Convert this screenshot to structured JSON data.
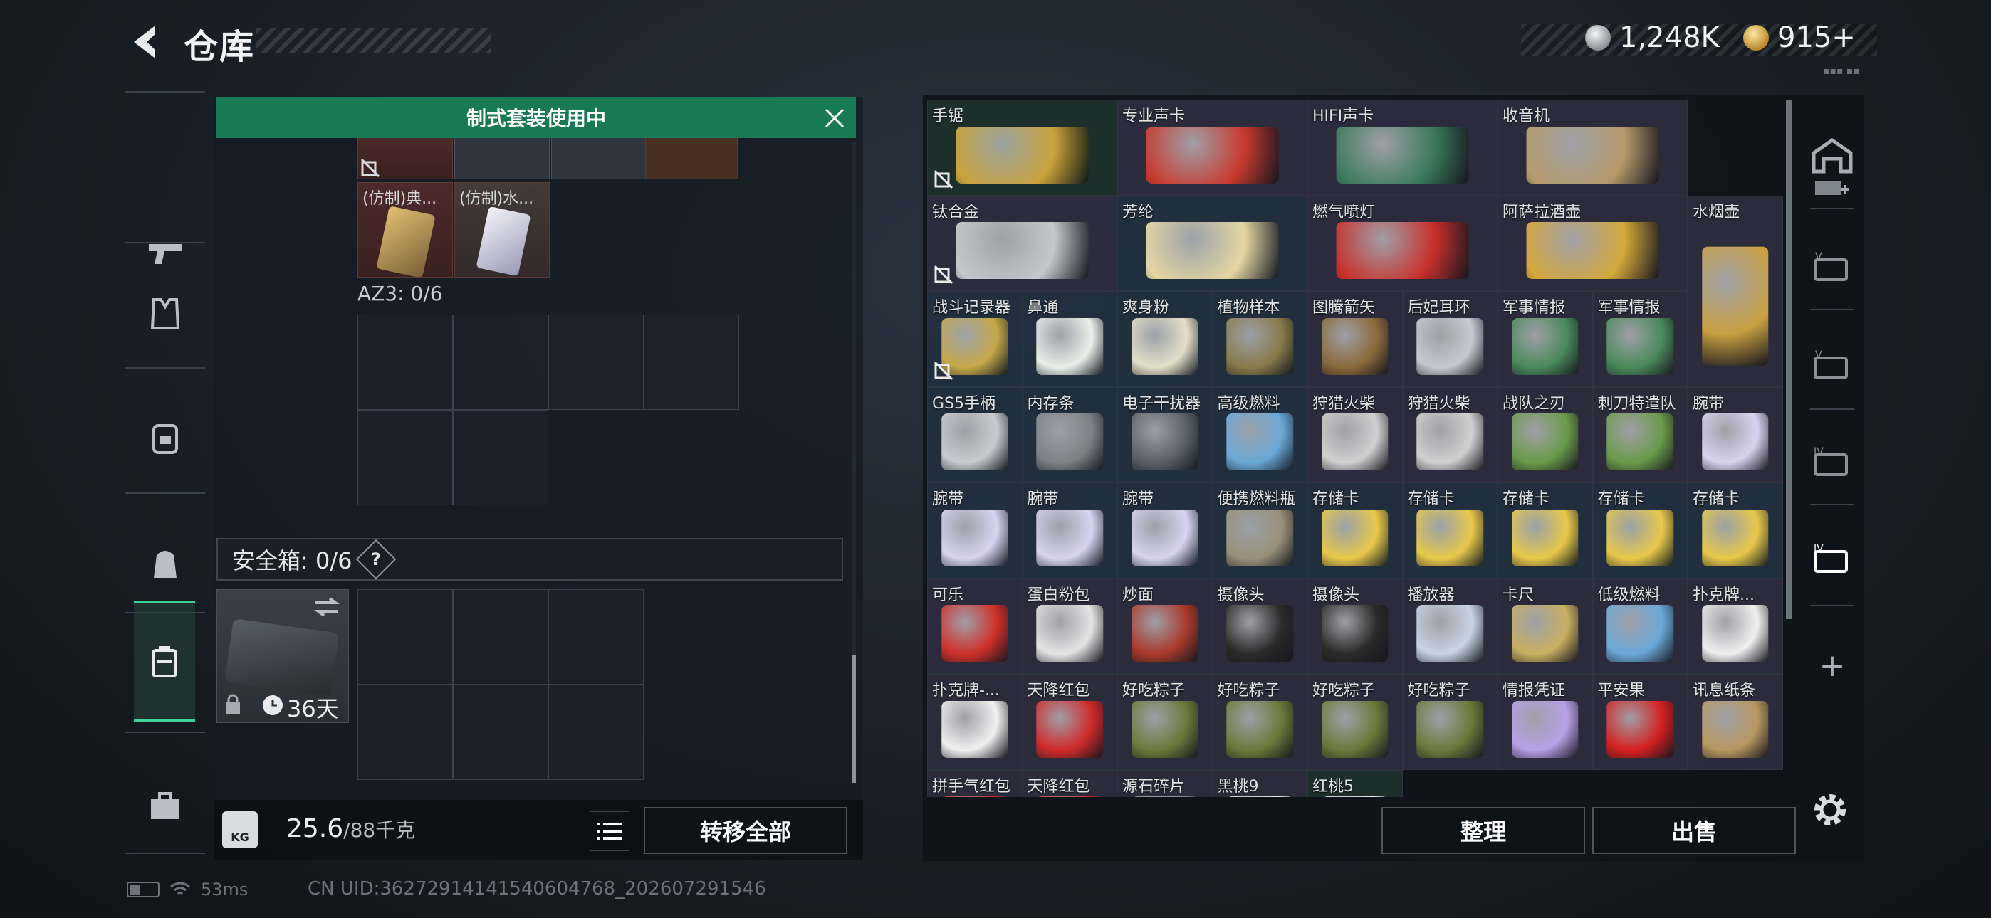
{
  "header": {
    "title": "仓库"
  },
  "currency": {
    "silver": "1,248K",
    "gold": "915+"
  },
  "left": {
    "banner": "制式套装使用中",
    "items": [
      "(仿制)典...",
      "(仿制)水..."
    ],
    "az3_label": "AZ3: 0/6",
    "safe_box": {
      "label": "安全箱: 0/6",
      "help": "?"
    },
    "case_days": "36天",
    "weight": {
      "value": "25.6",
      "max": "/88千克",
      "icon_text": "KG"
    },
    "transfer_all": "转移全部"
  },
  "inventory": {
    "rows": [
      [
        {
          "name": "手锯",
          "span": 2,
          "color": "green",
          "icon": "hacksaw-icon",
          "nolock": true
        },
        {
          "name": "专业声卡",
          "span": 2,
          "color": "purple",
          "icon": "sound-card-icon"
        },
        {
          "name": "HIFI声卡",
          "span": 2,
          "color": "purple",
          "icon": "hifi-card-icon"
        },
        {
          "name": "收音机",
          "span": 2,
          "color": "purple",
          "icon": "radio-icon"
        }
      ],
      [
        {
          "name": "钛合金",
          "span": 2,
          "color": "purple",
          "icon": "titanium-plate-icon",
          "nolock": true
        },
        {
          "name": "芳纶",
          "span": 2,
          "color": "blue",
          "icon": "aramid-roll-icon"
        },
        {
          "name": "燃气喷灯",
          "span": 2,
          "color": "purple",
          "icon": "gas-torch-icon"
        },
        {
          "name": "阿萨拉酒壶",
          "span": 2,
          "color": "purple",
          "icon": "wine-jug-icon"
        },
        {
          "name": "水烟壶",
          "span": 1,
          "color": "purple",
          "icon": "hookah-icon",
          "rowspan": 2
        }
      ],
      [
        {
          "name": "战斗记录器",
          "color": "blue",
          "icon": "combat-recorder-icon",
          "nolock": true
        },
        {
          "name": "鼻通",
          "color": "blue",
          "icon": "nasal-stick-icon"
        },
        {
          "name": "爽身粉",
          "color": "blue",
          "icon": "powder-can-icon"
        },
        {
          "name": "植物样本",
          "color": "blue",
          "icon": "plant-sample-icon"
        },
        {
          "name": "图腾箭矢",
          "color": "purple",
          "icon": "totem-arrow-icon"
        },
        {
          "name": "后妃耳环",
          "color": "purple",
          "icon": "earring-icon"
        },
        {
          "name": "军事情报",
          "color": "purple",
          "icon": "intel-board-icon"
        },
        {
          "name": "军事情报",
          "color": "purple",
          "icon": "intel-board-icon"
        }
      ],
      [
        {
          "name": "GS5手柄",
          "color": "blue",
          "icon": "gamepad-icon"
        },
        {
          "name": "内存条",
          "color": "blue",
          "icon": "ram-stick-icon"
        },
        {
          "name": "电子干扰器",
          "color": "blue",
          "icon": "jammer-icon"
        },
        {
          "name": "高级燃料",
          "color": "blue",
          "icon": "fuel-can-icon"
        },
        {
          "name": "狩猎火柴",
          "color": "purple",
          "icon": "matches-icon"
        },
        {
          "name": "狩猎火柴",
          "color": "purple",
          "icon": "matches-icon"
        },
        {
          "name": "战队之刃",
          "color": "purple",
          "icon": "book-icon"
        },
        {
          "name": "刺刀特遣队",
          "color": "purple",
          "icon": "book-icon"
        },
        {
          "name": "腕带",
          "color": "purple",
          "icon": "wristband-icon"
        }
      ],
      [
        {
          "name": "腕带",
          "color": "blue",
          "icon": "wristband-icon"
        },
        {
          "name": "腕带",
          "color": "blue",
          "icon": "wristband-icon"
        },
        {
          "name": "腕带",
          "color": "blue",
          "icon": "wristband-icon"
        },
        {
          "name": "便携燃料瓶",
          "color": "blue",
          "icon": "fuel-bottle-icon"
        },
        {
          "name": "存储卡",
          "color": "blue",
          "icon": "sd-card-icon"
        },
        {
          "name": "存储卡",
          "color": "blue",
          "icon": "sd-card-icon"
        },
        {
          "name": "存储卡",
          "color": "blue",
          "icon": "sd-card-icon"
        },
        {
          "name": "存储卡",
          "color": "blue",
          "icon": "sd-card-icon"
        },
        {
          "name": "存储卡",
          "color": "blue",
          "icon": "sd-card-icon"
        }
      ],
      [
        {
          "name": "可乐",
          "color": "purple",
          "icon": "cola-can-icon"
        },
        {
          "name": "蛋白粉包",
          "color": "purple",
          "icon": "protein-bag-icon"
        },
        {
          "name": "炒面",
          "color": "purple",
          "icon": "noodle-bag-icon"
        },
        {
          "name": "摄像头",
          "color": "purple",
          "icon": "camera-icon"
        },
        {
          "name": "摄像头",
          "color": "purple",
          "icon": "camera-icon"
        },
        {
          "name": "播放器",
          "color": "purple",
          "icon": "player-icon"
        },
        {
          "name": "卡尺",
          "color": "purple",
          "icon": "caliper-icon"
        },
        {
          "name": "低级燃料",
          "color": "purple",
          "icon": "fuel-can-icon"
        },
        {
          "name": "扑克牌...",
          "color": "purple",
          "icon": "poker-card-icon"
        }
      ],
      [
        {
          "name": "扑克牌-...",
          "color": "purple",
          "icon": "poker-card-icon"
        },
        {
          "name": "天降红包",
          "color": "purple",
          "icon": "red-envelope-icon"
        },
        {
          "name": "好吃粽子",
          "color": "purple",
          "icon": "zongzi-icon"
        },
        {
          "name": "好吃粽子",
          "color": "purple",
          "icon": "zongzi-icon"
        },
        {
          "name": "好吃粽子",
          "color": "purple",
          "icon": "zongzi-icon"
        },
        {
          "name": "好吃粽子",
          "color": "purple",
          "icon": "zongzi-icon"
        },
        {
          "name": "情报凭证",
          "color": "purple",
          "icon": "intel-voucher-icon"
        },
        {
          "name": "平安果",
          "color": "purple",
          "icon": "apple-icon"
        },
        {
          "name": "讯息纸条",
          "color": "purple",
          "icon": "note-paper-icon"
        }
      ],
      [
        {
          "name": "拼手气红包",
          "color": "purple",
          "icon": "red-envelope-icon"
        },
        {
          "name": "天降红包",
          "color": "purple",
          "icon": "red-envelope-icon"
        },
        {
          "name": "源石碎片",
          "color": "purple",
          "icon": "shard-icon"
        },
        {
          "name": "黑桃9",
          "color": "purple",
          "icon": "poker-card-icon"
        },
        {
          "name": "红桃5",
          "color": "green",
          "icon": "poker-card-icon"
        }
      ]
    ]
  },
  "actions": {
    "sort": "整理",
    "sell": "出售"
  },
  "status": {
    "ping": "53ms",
    "uid": "CN UID:3627291414154060476​8_202607291546"
  },
  "right_rail_plus": "+",
  "top_right_tiny": "▪▪▪ ▪▪"
}
